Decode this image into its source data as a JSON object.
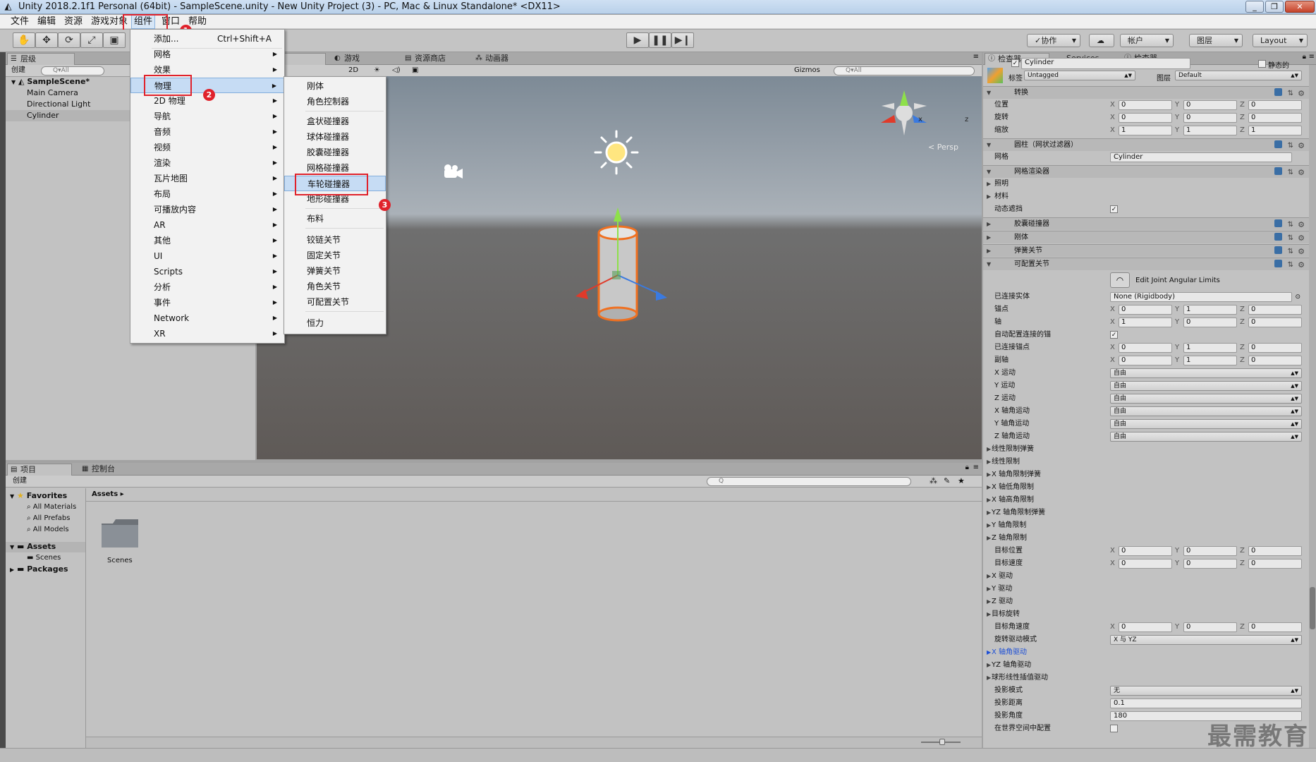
{
  "window": {
    "title": "Unity 2018.2.1f1 Personal (64bit) - SampleScene.unity - New Unity Project (3) - PC, Mac & Linux Standalone* <DX11>",
    "controls": [
      "_",
      "❐",
      "✕"
    ]
  },
  "menubar": [
    "文件",
    "编辑",
    "资源",
    "游戏对象",
    "组件",
    "窗口",
    "帮助"
  ],
  "toolbar": {
    "collab": "✓协作",
    "account": "帐户",
    "layers": "图层",
    "layout": "Layout"
  },
  "hierarchy": {
    "tab": "层级",
    "create": "创建",
    "search_placeholder": "Q▾All",
    "scene": "SampleScene*",
    "items": [
      "Main Camera",
      "Directional Light",
      "Cylinder"
    ]
  },
  "scene_view": {
    "tabs": [
      "游戏",
      "资源商店",
      "动画器"
    ],
    "mode2d": "2D",
    "gizmos": "Gizmos",
    "search_placeholder": "Q▾All",
    "persp": "< Persp",
    "axes": {
      "x": "x",
      "z": "z"
    }
  },
  "component_menu": {
    "items": [
      {
        "label": "添加...",
        "shortcut": "Ctrl+Shift+A"
      },
      {
        "label": "网格"
      },
      {
        "label": "效果"
      },
      {
        "label": "物理"
      },
      {
        "label": "2D 物理"
      },
      {
        "label": "导航"
      },
      {
        "label": "音频"
      },
      {
        "label": "视频"
      },
      {
        "label": "渲染"
      },
      {
        "label": "瓦片地图"
      },
      {
        "label": "布局"
      },
      {
        "label": "可播放内容"
      },
      {
        "label": "AR"
      },
      {
        "label": "其他"
      },
      {
        "label": "UI"
      },
      {
        "label": "Scripts"
      },
      {
        "label": "分析"
      },
      {
        "label": "事件"
      },
      {
        "label": "Network"
      },
      {
        "label": "XR"
      }
    ]
  },
  "physics_menu": {
    "items": [
      "刚体",
      "角色控制器",
      "盒状碰撞器",
      "球体碰撞器",
      "胶囊碰撞器",
      "网格碰撞器",
      "车轮碰撞器",
      "地形碰撞器",
      "布料",
      "铰链关节",
      "固定关节",
      "弹簧关节",
      "角色关节",
      "可配置关节",
      "恒力"
    ]
  },
  "annotations": [
    "1",
    "2",
    "3"
  ],
  "inspector": {
    "tabs": [
      "检查器",
      "Services",
      "检查器"
    ],
    "object_name": "Cylinder",
    "static_label": "静态的",
    "tag_label": "标签",
    "tag_value": "Untagged",
    "layer_label": "图层",
    "layer_value": "Default",
    "transform": {
      "title": "转换",
      "rows": [
        {
          "label": "位置",
          "x": "0",
          "y": "0",
          "z": "0"
        },
        {
          "label": "旋转",
          "x": "0",
          "y": "0",
          "z": "0"
        },
        {
          "label": "缩放",
          "x": "1",
          "y": "1",
          "z": "1"
        }
      ]
    },
    "mesh_filter": {
      "title": "圆柱（网状过滤器）",
      "mesh_label": "网格",
      "mesh_value": "Cylinder"
    },
    "mesh_renderer": {
      "title": "网格渲染器",
      "lighting": "照明",
      "materials": "材料",
      "dynamic_occluded": "动态遮挡"
    },
    "capsule_collider": "胶囊碰撞器",
    "rigidbody": "刚体",
    "spring_joint": "弹簧关节",
    "configurable_joint": {
      "title": "可配置关节",
      "edit_limits": "Edit Joint Angular Limits",
      "connected_body_label": "已连接实体",
      "connected_body_value": "None (Rigidbody)",
      "anchor": {
        "label": "锚点",
        "x": "0",
        "y": "1",
        "z": "0"
      },
      "axis": {
        "label": "轴",
        "x": "1",
        "y": "0",
        "z": "0"
      },
      "auto_configure": "自动配置连接的锚",
      "connected_anchor": {
        "label": "已连接锚点",
        "x": "0",
        "y": "1",
        "z": "0"
      },
      "secondary_axis": {
        "label": "副轴",
        "x": "0",
        "y": "1",
        "z": "0"
      },
      "motions": [
        {
          "label": "X 运动",
          "value": "自由"
        },
        {
          "label": "Y 运动",
          "value": "自由"
        },
        {
          "label": "Z 运动",
          "value": "自由"
        },
        {
          "label": "X 轴角运动",
          "value": "自由"
        },
        {
          "label": "Y 轴角运动",
          "value": "自由"
        },
        {
          "label": "Z 轴角运动",
          "value": "自由"
        }
      ],
      "foldouts1": [
        "线性限制弹簧",
        "线性限制",
        "X 轴角限制弹簧",
        "X 轴低角限制",
        "X 轴高角限制",
        "YZ 轴角限制弹簧",
        "Y 轴角限制",
        "Z 轴角限制"
      ],
      "target_position": {
        "label": "目标位置",
        "x": "0",
        "y": "0",
        "z": "0"
      },
      "target_velocity": {
        "label": "目标速度",
        "x": "0",
        "y": "0",
        "z": "0"
      },
      "foldouts2": [
        "X 驱动",
        "Y 驱动",
        "Z 驱动",
        "目标旋转"
      ],
      "target_angular_velocity": {
        "label": "目标角速度",
        "x": "0",
        "y": "0",
        "z": "0"
      },
      "rotation_drive_mode": {
        "label": "旋转驱动模式",
        "value": "X 与 YZ"
      },
      "x_angular_drive": "X 轴角驱动",
      "yz_angular_drive": "YZ 轴角驱动",
      "slerp_drive": "球形线性插值驱动",
      "projection_mode": {
        "label": "投影模式",
        "value": "无"
      },
      "projection_distance": {
        "label": "投影距离",
        "value": "0.1"
      },
      "projection_angle": {
        "label": "投影角度",
        "value": "180"
      },
      "world_space": "在世界空间中配置"
    }
  },
  "project": {
    "tabs": [
      "项目",
      "控制台"
    ],
    "create": "创建",
    "favorites_label": "Favorites",
    "favorites": [
      "All Materials",
      "All Prefabs",
      "All Models"
    ],
    "assets_label": "Assets",
    "assets_children": [
      "Scenes"
    ],
    "packages_label": "Packages",
    "breadcrumb": "Assets ▸",
    "folder_name": "Scenes"
  },
  "watermark": "最需教育",
  "colors": {
    "highlight_red": "#e0222b",
    "menu_highlight": "#c6dcf4",
    "selection": "#8fa4c3"
  }
}
